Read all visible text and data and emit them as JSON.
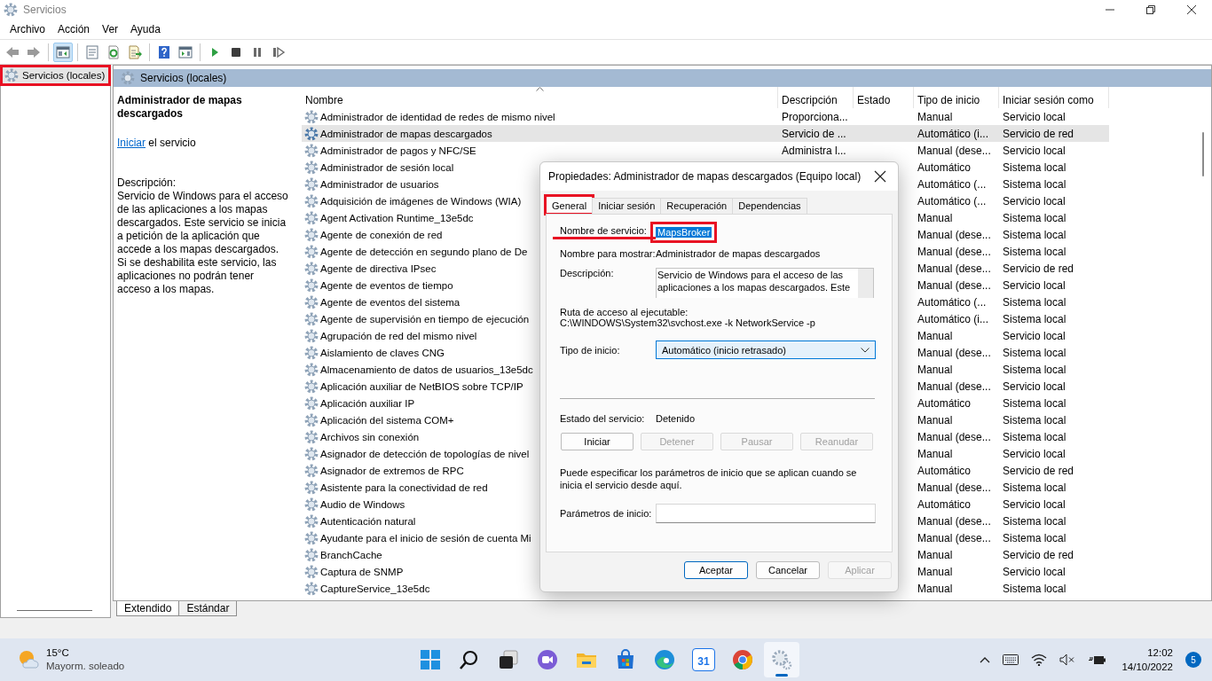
{
  "window": {
    "title": "Servicios"
  },
  "menu": [
    "Archivo",
    "Acción",
    "Ver",
    "Ayuda"
  ],
  "toolbar": [
    {
      "kind": "back",
      "pressed": false
    },
    {
      "kind": "forward",
      "pressed": false
    },
    {
      "kind": "sep"
    },
    {
      "kind": "console-tree",
      "pressed": true
    },
    {
      "kind": "sep"
    },
    {
      "kind": "properties",
      "pressed": false
    },
    {
      "kind": "refresh",
      "pressed": false
    },
    {
      "kind": "export",
      "pressed": false
    },
    {
      "kind": "sep"
    },
    {
      "kind": "help",
      "pressed": false
    },
    {
      "kind": "action-pane",
      "pressed": false
    },
    {
      "kind": "sep"
    },
    {
      "kind": "play",
      "pressed": false
    },
    {
      "kind": "stop",
      "pressed": false
    },
    {
      "kind": "pause",
      "pressed": false
    },
    {
      "kind": "resume",
      "pressed": false
    }
  ],
  "tree": {
    "items": [
      {
        "label": "Servicios (locales)",
        "selected": true,
        "highlighted": true
      }
    ]
  },
  "pane_header": "Servicios (locales)",
  "detail": {
    "title": "Administrador de mapas descargados",
    "action_link": "Iniciar",
    "action_text": "el servicio",
    "description_label": "Descripción:",
    "description": "Servicio de Windows para el acceso de las aplicaciones a los mapas descargados. Este servicio se inicia a petición de la aplicación que accede a los mapas descargados. Si se deshabilita este servicio, las aplicaciones no podrán tener acceso a los mapas."
  },
  "table": {
    "columns": [
      {
        "label": "Nombre",
        "sorted": true
      },
      {
        "label": "Descripción",
        "sorted": false
      },
      {
        "label": "Estado",
        "sorted": false
      },
      {
        "label": "Tipo de inicio",
        "sorted": false
      },
      {
        "label": "Iniciar sesión como",
        "sorted": false
      }
    ],
    "rows": [
      {
        "name": "Administrador de identidad de redes de mismo nivel",
        "description": "Proporciona...",
        "startup": "Manual",
        "logon": "Servicio local",
        "selected": false
      },
      {
        "name": "Administrador de mapas descargados",
        "description": "Servicio de ...",
        "startup": "Automático (i...",
        "logon": "Servicio de red",
        "selected": true
      },
      {
        "name": "Administrador de pagos y NFC/SE",
        "description": "Administra l...",
        "startup": "Manual (dese...",
        "logon": "Servicio local",
        "selected": false
      },
      {
        "name": "Administrador de sesión local",
        "startup": "Automático",
        "logon": "Sistema local",
        "selected": false
      },
      {
        "name": "Administrador de usuarios",
        "startup": "Automático (...",
        "logon": "Sistema local",
        "selected": false
      },
      {
        "name": "Adquisición de imágenes de Windows (WIA)",
        "startup": "Automático (...",
        "logon": "Servicio local",
        "selected": false
      },
      {
        "name": "Agent Activation Runtime_13e5dc",
        "startup": "Manual",
        "logon": "Sistema local",
        "selected": false
      },
      {
        "name": "Agente de conexión de red",
        "startup": "Manual (dese...",
        "logon": "Sistema local",
        "selected": false
      },
      {
        "name": "Agente de detección en segundo plano de De",
        "startup": "Manual (dese...",
        "logon": "Sistema local",
        "selected": false
      },
      {
        "name": "Agente de directiva IPsec",
        "startup": "Manual (dese...",
        "logon": "Servicio de red",
        "selected": false
      },
      {
        "name": "Agente de eventos de tiempo",
        "startup": "Manual (dese...",
        "logon": "Servicio local",
        "selected": false
      },
      {
        "name": "Agente de eventos del sistema",
        "startup": "Automático (...",
        "logon": "Sistema local",
        "selected": false
      },
      {
        "name": "Agente de supervisión en tiempo de ejecución",
        "startup": "Automático (i...",
        "logon": "Sistema local",
        "selected": false
      },
      {
        "name": "Agrupación de red del mismo nivel",
        "startup": "Manual",
        "logon": "Servicio local",
        "selected": false
      },
      {
        "name": "Aislamiento de claves CNG",
        "startup": "Manual (dese...",
        "logon": "Sistema local",
        "selected": false
      },
      {
        "name": "Almacenamiento de datos de usuarios_13e5dc",
        "startup": "Manual",
        "logon": "Sistema local",
        "selected": false
      },
      {
        "name": "Aplicación auxiliar de NetBIOS sobre TCP/IP",
        "startup": "Manual (dese...",
        "logon": "Servicio local",
        "selected": false
      },
      {
        "name": "Aplicación auxiliar IP",
        "startup": "Automático",
        "logon": "Sistema local",
        "selected": false
      },
      {
        "name": "Aplicación del sistema COM+",
        "startup": "Manual",
        "logon": "Sistema local",
        "selected": false
      },
      {
        "name": "Archivos sin conexión",
        "startup": "Manual (dese...",
        "logon": "Sistema local",
        "selected": false
      },
      {
        "name": "Asignador de detección de topologías de nivel",
        "startup": "Manual",
        "logon": "Servicio local",
        "selected": false
      },
      {
        "name": "Asignador de extremos de RPC",
        "startup": "Automático",
        "logon": "Servicio de red",
        "selected": false
      },
      {
        "name": "Asistente para la conectividad de red",
        "startup": "Manual (dese...",
        "logon": "Sistema local",
        "selected": false
      },
      {
        "name": "Audio de Windows",
        "startup": "Automático",
        "logon": "Servicio local",
        "selected": false
      },
      {
        "name": "Autenticación natural",
        "startup": "Manual (dese...",
        "logon": "Sistema local",
        "selected": false
      },
      {
        "name": "Ayudante para el inicio de sesión de cuenta Mi",
        "startup": "Manual (dese...",
        "logon": "Sistema local",
        "selected": false
      },
      {
        "name": "BranchCache",
        "startup": "Manual",
        "logon": "Servicio de red",
        "selected": false
      },
      {
        "name": "Captura de SNMP",
        "startup": "Manual",
        "logon": "Servicio local",
        "selected": false
      },
      {
        "name": "CaptureService_13e5dc",
        "startup": "Manual",
        "logon": "Sistema local",
        "selected": false
      }
    ]
  },
  "view_tabs": [
    {
      "label": "Extendido",
      "selected": true
    },
    {
      "label": "Estándar",
      "selected": false
    }
  ],
  "dialog": {
    "title": "Propiedades: Administrador de mapas descargados (Equipo local)",
    "tabs": [
      {
        "label": "General",
        "selected": true,
        "highlighted": true
      },
      {
        "label": "Iniciar sesión",
        "selected": false,
        "highlighted": false
      },
      {
        "label": "Recuperación",
        "selected": false,
        "highlighted": false
      },
      {
        "label": "Dependencias",
        "selected": false,
        "highlighted": false
      }
    ],
    "service_name": {
      "label": "Nombre de servicio:",
      "value": "MapsBroker",
      "underlined": true,
      "highlighted": true,
      "text_selected": true
    },
    "display_name": {
      "label": "Nombre para mostrar:",
      "value": "Administrador de mapas descargados"
    },
    "description": {
      "label": "Descripción:",
      "lines": [
        "Servicio de Windows para el acceso de las",
        "aplicaciones a los mapas descargados. Este"
      ]
    },
    "path": {
      "label": "Ruta de acceso al ejecutable:",
      "value": "C:\\WINDOWS\\System32\\svchost.exe -k NetworkService -p"
    },
    "startup_type": {
      "label": "Tipo de inicio:",
      "value": "Automático (inicio retrasado)"
    },
    "status": {
      "label": "Estado del servicio:",
      "value": "Detenido"
    },
    "service_buttons": [
      {
        "label": "Iniciar",
        "disabled": false
      },
      {
        "label": "Detener",
        "disabled": true
      },
      {
        "label": "Pausar",
        "disabled": true
      },
      {
        "label": "Reanudar",
        "disabled": true
      }
    ],
    "hint": "Puede especificar los parámetros de inicio que se aplican cuando se inicia el servicio desde aquí.",
    "params": {
      "label": "Parámetros de inicio:"
    },
    "buttons": [
      {
        "label": "Aceptar",
        "disabled": false,
        "default": true
      },
      {
        "label": "Cancelar",
        "disabled": false,
        "default": false
      },
      {
        "label": "Aplicar",
        "disabled": true,
        "default": false
      }
    ]
  },
  "taskbar": {
    "weather": {
      "temperature": "15°C",
      "condition": "Mayorm. soleado"
    },
    "apps": [
      {
        "kind": "start",
        "active": false
      },
      {
        "kind": "search",
        "active": false
      },
      {
        "kind": "taskview",
        "active": false
      },
      {
        "kind": "chat",
        "active": false
      },
      {
        "kind": "explorer",
        "active": false
      },
      {
        "kind": "store",
        "active": false
      },
      {
        "kind": "edge",
        "active": false
      },
      {
        "kind": "calendar",
        "label": "31",
        "active": false
      },
      {
        "kind": "chrome",
        "active": false
      },
      {
        "kind": "services",
        "active": true
      }
    ],
    "tray": [
      {
        "kind": "chevron"
      },
      {
        "kind": "keyboard"
      },
      {
        "kind": "wifi"
      },
      {
        "kind": "volume-muted"
      },
      {
        "kind": "battery"
      }
    ],
    "clock": {
      "time": "12:02",
      "date": "14/10/2022"
    },
    "notifications": "5"
  }
}
